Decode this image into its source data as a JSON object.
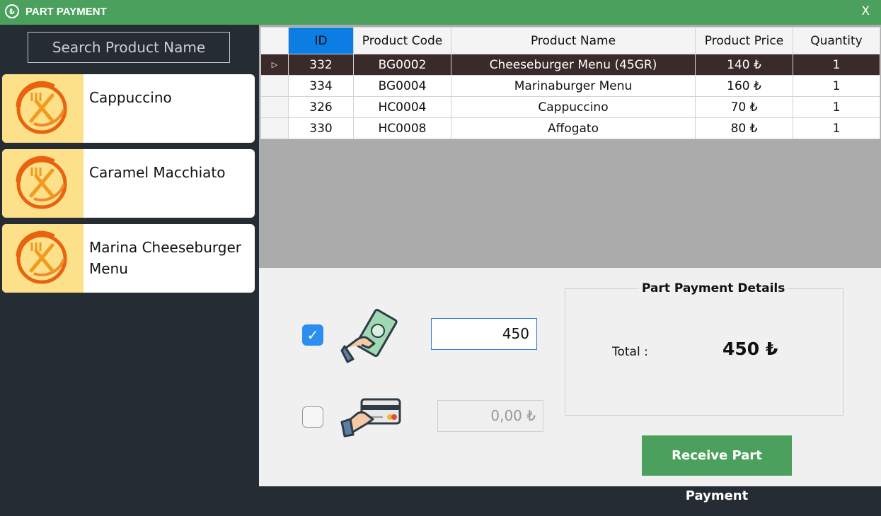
{
  "window": {
    "title": "PART PAYMENT",
    "close_label": "X",
    "logo_glyph": "₺"
  },
  "search": {
    "placeholder": "Search Product Name"
  },
  "products": [
    {
      "name": "Cappuccino"
    },
    {
      "name": "Caramel Macchiato"
    },
    {
      "name": "Marina Cheeseburger Menu"
    }
  ],
  "grid": {
    "columns": [
      "ID",
      "Product Code",
      "Product Name",
      "Product Price",
      "Quantity"
    ],
    "selected_row_marker": "▷",
    "rows": [
      {
        "id": "332",
        "code": "BG0002",
        "name": "Cheeseburger Menu (45GR)",
        "price": "140 ₺",
        "qty": "1"
      },
      {
        "id": "334",
        "code": "BG0004",
        "name": "Marinaburger Menu",
        "price": "160 ₺",
        "qty": "1"
      },
      {
        "id": "326",
        "code": "HC0004",
        "name": "Cappuccino",
        "price": "70 ₺",
        "qty": "1"
      },
      {
        "id": "330",
        "code": "HC0008",
        "name": "Affogato",
        "price": "80 ₺",
        "qty": "1"
      }
    ]
  },
  "payment": {
    "cash": {
      "checked": true,
      "check_glyph": "✓",
      "value": "450",
      "icon": "cash-hand-icon"
    },
    "card": {
      "checked": false,
      "value": "0,00 ₺",
      "icon": "card-hand-icon"
    }
  },
  "details": {
    "title": "Part Payment Details",
    "total_label": "Total :",
    "total_value": "450 ₺"
  },
  "actions": {
    "receive_label": "Receive Part Payment"
  },
  "colors": {
    "title_bar": "#4aa05c",
    "sidebar": "#262c33",
    "selected_row": "#3a2a2a",
    "accent_blue": "#0c7ee3",
    "button_green": "#4aa05c",
    "product_thumb_bg": "#fde08a"
  }
}
